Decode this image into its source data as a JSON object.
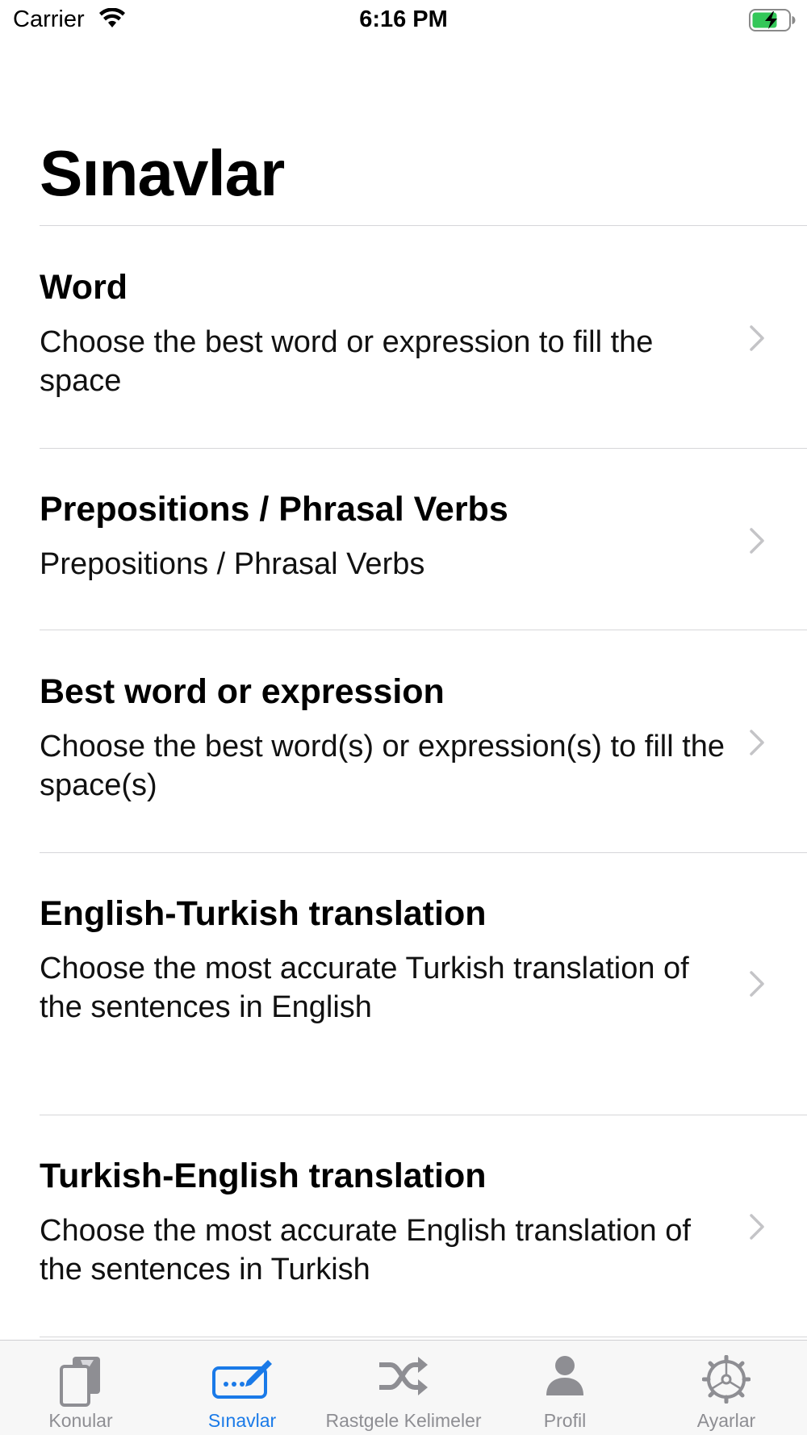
{
  "status_bar": {
    "carrier": "Carrier",
    "time": "6:16 PM",
    "wifi_icon": "wifi-icon",
    "battery_icon": "battery-charging-icon"
  },
  "page": {
    "title": "Sınavlar"
  },
  "exams": [
    {
      "title": "Word",
      "description": "Choose the best word or expression to fill the space"
    },
    {
      "title": "Prepositions / Phrasal Verbs",
      "description": "Prepositions / Phrasal Verbs"
    },
    {
      "title": "Best word or expression",
      "description": "Choose the best word(s) or expression(s) to fill the space(s)"
    },
    {
      "title": "English-Turkish translation",
      "description": "Choose the most accurate Turkish translation of the sentences in English"
    },
    {
      "title": "Turkish-English translation",
      "description": "Choose the most accurate English translation of the sentences in Turkish"
    }
  ],
  "tab_bar": {
    "tabs": [
      {
        "label": "Konular",
        "icon": "book-icon",
        "active": false
      },
      {
        "label": "Sınavlar",
        "icon": "keyboard-pencil-icon",
        "active": true
      },
      {
        "label": "Rastgele Kelimeler",
        "icon": "shuffle-icon",
        "active": false
      },
      {
        "label": "Profil",
        "icon": "person-icon",
        "active": false
      },
      {
        "label": "Ayarlar",
        "icon": "gear-icon",
        "active": false
      }
    ]
  },
  "colors": {
    "accent": "#1a7ae8",
    "inactive": "#8e8e93",
    "battery_fill": "#34c759",
    "divider": "#d6d6d9"
  }
}
